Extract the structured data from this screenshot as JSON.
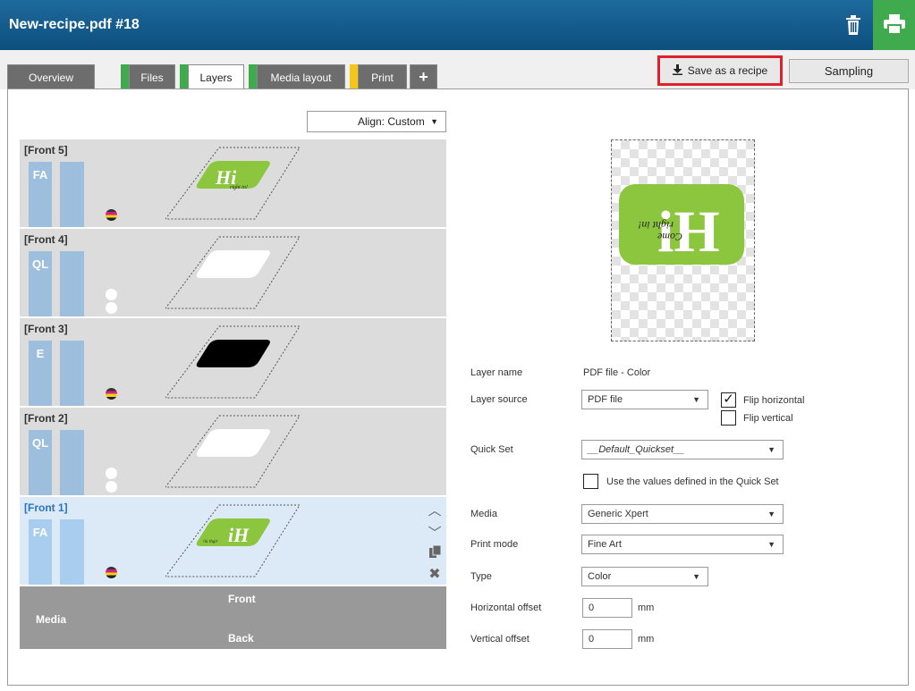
{
  "window": {
    "title": "New-recipe.pdf #18"
  },
  "tabs": [
    {
      "label": "Overview"
    },
    {
      "label": "Files",
      "mark_color": "#3faa4e"
    },
    {
      "label": "Layers",
      "mark_color": "#3faa4e"
    },
    {
      "label": "Media layout",
      "mark_color": "#3faa4e"
    },
    {
      "label": "Print",
      "mark_color": "#f5c518"
    },
    {
      "label": "+"
    }
  ],
  "toolbar": {
    "save_recipe": "Save as a recipe",
    "sampling": "Sampling"
  },
  "align": {
    "value": "Align: Custom"
  },
  "layers": [
    {
      "name": "[Front 5]",
      "tag": "FA",
      "indicator": "cmyk"
    },
    {
      "name": "[Front 4]",
      "tag": "QL",
      "indicator": "white-dots"
    },
    {
      "name": "[Front 3]",
      "tag": "E",
      "indicator": "cmyk"
    },
    {
      "name": "[Front 2]",
      "tag": "QL",
      "indicator": "white-dots"
    },
    {
      "name": "[Front 1]",
      "tag": "FA",
      "indicator": "cmyk",
      "selected": true
    }
  ],
  "media": {
    "label": "Media",
    "front": "Front",
    "back": "Back"
  },
  "props": {
    "layer_name_label": "Layer name",
    "layer_name_value": "PDF file - Color",
    "layer_source_label": "Layer source",
    "layer_source_value": "PDF file",
    "flip_horizontal": "Flip horizontal",
    "flip_horizontal_checked": true,
    "flip_vertical": "Flip vertical",
    "flip_vertical_checked": false,
    "quick_set_label": "Quick Set",
    "quick_set_value": "__Default_Quickset__",
    "use_values": "Use the values defined in the Quick Set",
    "media_label": "Media",
    "media_value": "Generic Xpert",
    "print_mode_label": "Print mode",
    "print_mode_value": "Fine Art",
    "type_label": "Type",
    "type_value": "Color",
    "h_offset_label": "Horizontal offset",
    "h_offset_value": "0",
    "v_offset_label": "Vertical offset",
    "v_offset_value": "0",
    "unit": "mm"
  },
  "preview_text": {
    "brand": "Hi",
    "script": "Come right in!"
  },
  "colors": {
    "header": "#0d4f7e",
    "print_green": "#3faa4e",
    "highlight_red": "#e0202a",
    "logo_green": "#8cc63f"
  },
  "icons": [
    "trash-icon",
    "printer-icon",
    "download-icon",
    "caret-down-icon",
    "move-up-icon",
    "move-down-icon",
    "copy-icon",
    "delete-icon"
  ]
}
